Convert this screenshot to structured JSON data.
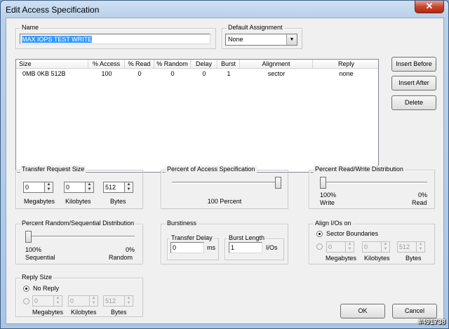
{
  "window": {
    "title": "Edit Access Specification",
    "close_glyph": "✕"
  },
  "name": {
    "label": "Name",
    "value": "MAX IOPS TEST WRITE"
  },
  "default_assignment": {
    "label": "Default Assignment",
    "value": "None"
  },
  "table": {
    "headers": [
      "Size",
      "% Access",
      "% Read",
      "% Random",
      "Delay",
      "Burst",
      "Alignment",
      "Reply"
    ],
    "rows": [
      [
        "0MB    0KB  512B",
        "100",
        "0",
        "0",
        "0",
        "1",
        "sector",
        "none"
      ]
    ]
  },
  "buttons": {
    "insert_before": "Insert Before",
    "insert_after": "Insert After",
    "delete": "Delete",
    "ok": "OK",
    "cancel": "Cancel"
  },
  "transfer_request_size": {
    "label": "Transfer Request Size",
    "values": [
      "0",
      "0",
      "512"
    ],
    "units": [
      "Megabytes",
      "Kilobytes",
      "Bytes"
    ]
  },
  "percent_access": {
    "label": "Percent of Access Specification",
    "caption": "100 Percent",
    "value": 100
  },
  "read_write": {
    "label": "Percent Read/Write Distribution",
    "left_value": "100%",
    "left_label": "Write",
    "right_value": "0%",
    "right_label": "Read",
    "read_percent": 0
  },
  "random_sequential": {
    "label": "Percent Random/Sequential Distribution",
    "left_value": "100%",
    "left_label": "Sequential",
    "right_value": "0%",
    "right_label": "Random",
    "random_percent": 0
  },
  "burstiness": {
    "label": "Burstiness",
    "transfer_delay_label": "Transfer Delay",
    "transfer_delay": "0",
    "transfer_delay_unit": "ms",
    "burst_length_label": "Burst Length",
    "burst_length": "1",
    "burst_length_unit": "I/Os"
  },
  "align": {
    "label": "Align I/Os on",
    "option_sector": "Sector Boundaries",
    "values": [
      "0",
      "0",
      "512"
    ],
    "units": [
      "Megabytes",
      "Kilobytes",
      "Bytes"
    ]
  },
  "reply_size": {
    "label": "Reply Size",
    "option_no_reply": "No Reply",
    "values": [
      "0",
      "0",
      "512"
    ],
    "units": [
      "Megabytes",
      "Kilobytes",
      "Bytes"
    ]
  },
  "watermark": "#491738"
}
